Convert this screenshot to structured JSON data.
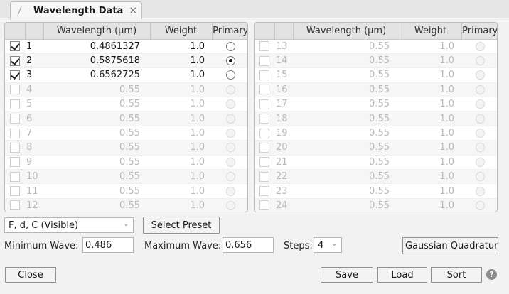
{
  "tab": {
    "title": "Wavelength Data",
    "close_glyph": "×"
  },
  "table": {
    "headers": {
      "wavelength": "Wavelength (µm)",
      "weight": "Weight",
      "primary": "Primary"
    }
  },
  "left_rows": [
    {
      "num": "1",
      "wavelength": "0.4861327",
      "weight": "1.0",
      "checked": true,
      "primary": false,
      "enabled": true
    },
    {
      "num": "2",
      "wavelength": "0.5875618",
      "weight": "1.0",
      "checked": true,
      "primary": true,
      "enabled": true
    },
    {
      "num": "3",
      "wavelength": "0.6562725",
      "weight": "1.0",
      "checked": true,
      "primary": false,
      "enabled": true
    },
    {
      "num": "4",
      "wavelength": "0.55",
      "weight": "1.0",
      "checked": false,
      "primary": false,
      "enabled": false
    },
    {
      "num": "5",
      "wavelength": "0.55",
      "weight": "1.0",
      "checked": false,
      "primary": false,
      "enabled": false
    },
    {
      "num": "6",
      "wavelength": "0.55",
      "weight": "1.0",
      "checked": false,
      "primary": false,
      "enabled": false
    },
    {
      "num": "7",
      "wavelength": "0.55",
      "weight": "1.0",
      "checked": false,
      "primary": false,
      "enabled": false
    },
    {
      "num": "8",
      "wavelength": "0.55",
      "weight": "1.0",
      "checked": false,
      "primary": false,
      "enabled": false
    },
    {
      "num": "9",
      "wavelength": "0.55",
      "weight": "1.0",
      "checked": false,
      "primary": false,
      "enabled": false
    },
    {
      "num": "10",
      "wavelength": "0.55",
      "weight": "1.0",
      "checked": false,
      "primary": false,
      "enabled": false
    },
    {
      "num": "11",
      "wavelength": "0.55",
      "weight": "1.0",
      "checked": false,
      "primary": false,
      "enabled": false
    },
    {
      "num": "12",
      "wavelength": "0.55",
      "weight": "1.0",
      "checked": false,
      "primary": false,
      "enabled": false
    }
  ],
  "right_rows": [
    {
      "num": "13",
      "wavelength": "0.55",
      "weight": "1.0",
      "checked": false,
      "primary": false,
      "enabled": false
    },
    {
      "num": "14",
      "wavelength": "0.55",
      "weight": "1.0",
      "checked": false,
      "primary": false,
      "enabled": false
    },
    {
      "num": "15",
      "wavelength": "0.55",
      "weight": "1.0",
      "checked": false,
      "primary": false,
      "enabled": false
    },
    {
      "num": "16",
      "wavelength": "0.55",
      "weight": "1.0",
      "checked": false,
      "primary": false,
      "enabled": false
    },
    {
      "num": "17",
      "wavelength": "0.55",
      "weight": "1.0",
      "checked": false,
      "primary": false,
      "enabled": false
    },
    {
      "num": "18",
      "wavelength": "0.55",
      "weight": "1.0",
      "checked": false,
      "primary": false,
      "enabled": false
    },
    {
      "num": "19",
      "wavelength": "0.55",
      "weight": "1.0",
      "checked": false,
      "primary": false,
      "enabled": false
    },
    {
      "num": "20",
      "wavelength": "0.55",
      "weight": "1.0",
      "checked": false,
      "primary": false,
      "enabled": false
    },
    {
      "num": "21",
      "wavelength": "0.55",
      "weight": "1.0",
      "checked": false,
      "primary": false,
      "enabled": false
    },
    {
      "num": "22",
      "wavelength": "0.55",
      "weight": "1.0",
      "checked": false,
      "primary": false,
      "enabled": false
    },
    {
      "num": "23",
      "wavelength": "0.55",
      "weight": "1.0",
      "checked": false,
      "primary": false,
      "enabled": false
    },
    {
      "num": "24",
      "wavelength": "0.55",
      "weight": "1.0",
      "checked": false,
      "primary": false,
      "enabled": false
    }
  ],
  "preset": {
    "selected": "F, d, C (Visible)",
    "button_label": "Select Preset"
  },
  "range": {
    "min_label": "Minimum Wave:",
    "min_value": "0.486",
    "max_label": "Maximum Wave:",
    "max_value": "0.656",
    "steps_label": "Steps:",
    "steps_value": "4",
    "gauss_label": "Gaussian Quadrature"
  },
  "footer": {
    "close_label": "Close",
    "save_label": "Save",
    "load_label": "Load",
    "sort_label": "Sort",
    "help_glyph": "?"
  },
  "colors": {
    "panel_bg": "#ffffff",
    "header_bg": "#e3e3e3",
    "window_bg": "#f2f2f2",
    "disabled_text": "#b9b9b9"
  }
}
